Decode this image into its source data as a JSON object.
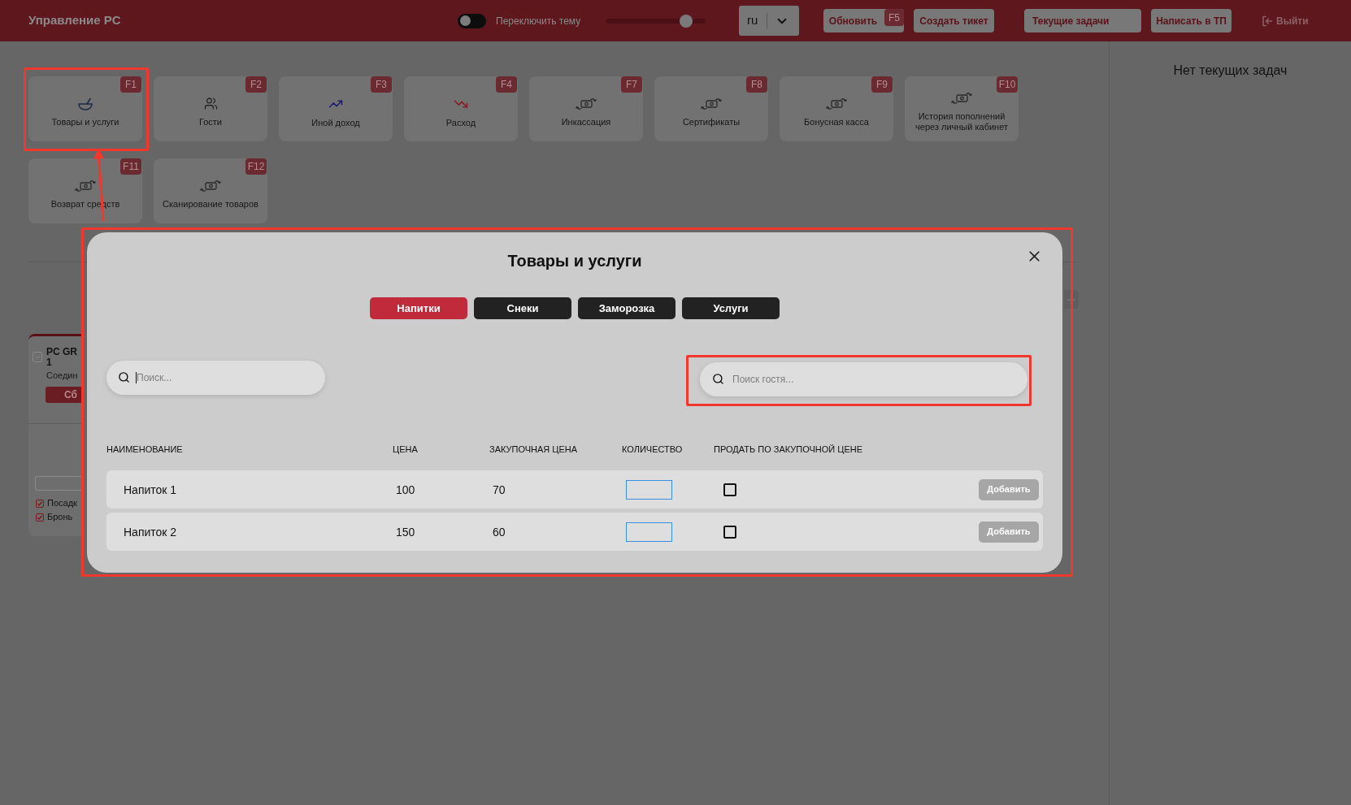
{
  "header": {
    "title": "Управление PC",
    "theme_toggle": {
      "label": "Переключить тему",
      "on": false
    },
    "slider": {
      "level": 0.8
    },
    "language": {
      "value": "ru"
    },
    "buttons": [
      {
        "label": "Обновить",
        "hotkey": "F5",
        "kind": "compact"
      },
      {
        "label": "Создать тикет",
        "kind": "compact"
      },
      {
        "label": "Текущие задачи",
        "kind": "wide"
      },
      {
        "label": "Написать в ТП",
        "kind": "compact"
      }
    ],
    "logout": {
      "label": "Выйти"
    }
  },
  "tiles": [
    {
      "label": "Товары и услуги",
      "hotkey": "F1",
      "kind": "goods"
    },
    {
      "label": "Гости",
      "hotkey": "F2",
      "kind": "guests"
    },
    {
      "label": "Иной доход",
      "hotkey": "F3",
      "kind": "income"
    },
    {
      "label": "Расход",
      "hotkey": "F4",
      "kind": "expense"
    },
    {
      "label": "Инкассация",
      "hotkey": "F7",
      "kind": "money"
    },
    {
      "label": "Сертификаты",
      "hotkey": "F8",
      "kind": "money"
    },
    {
      "label": "Бонусная касса",
      "hotkey": "F9",
      "kind": "money"
    },
    {
      "label": "История пополнений через личный кабинет",
      "hotkey": "F10",
      "kind": "money"
    },
    {
      "label": "Возврат средств",
      "hotkey": "F11",
      "kind": "money"
    },
    {
      "label": "Сканирование товаров",
      "hotkey": "F12",
      "kind": "money"
    }
  ],
  "sidebar": {
    "empty_text": "Нет текущих задач"
  },
  "pc_card": {
    "title": "PC GR",
    "title_line2": "1",
    "status": "Соедин",
    "button": "Сб",
    "options": [
      {
        "label": "Посадк",
        "checked": true
      },
      {
        "label": "Бронь",
        "checked": true
      }
    ]
  },
  "modal": {
    "title": "Товары и услуги",
    "tabs": [
      {
        "label": "Напитки",
        "selected": true
      },
      {
        "label": "Снеки",
        "selected": false
      },
      {
        "label": "Заморозка",
        "selected": false
      },
      {
        "label": "Услуги",
        "selected": false
      }
    ],
    "search": {
      "placeholder": "Поиск...",
      "focused": true
    },
    "guest_search": {
      "placeholder": "Поиск гостя...",
      "focused": false
    },
    "table": {
      "columns": [
        "НАИМЕНОВАНИЕ",
        "ЦЕНА",
        "ЗАКУПОЧНАЯ ЦЕНА",
        "КОЛИЧЕСТВО",
        "ПРОДАТЬ ПО ЗАКУПОЧНОЙ ЦЕНЕ"
      ],
      "rows": [
        {
          "name": "Напиток 1",
          "price": "100",
          "purchase_price": "70",
          "checked": false,
          "action": "Добавить",
          "disabled": true
        },
        {
          "name": "Напиток 2",
          "price": "150",
          "purchase_price": "60",
          "checked": false,
          "action": "Добавить",
          "disabled": true
        }
      ]
    }
  }
}
